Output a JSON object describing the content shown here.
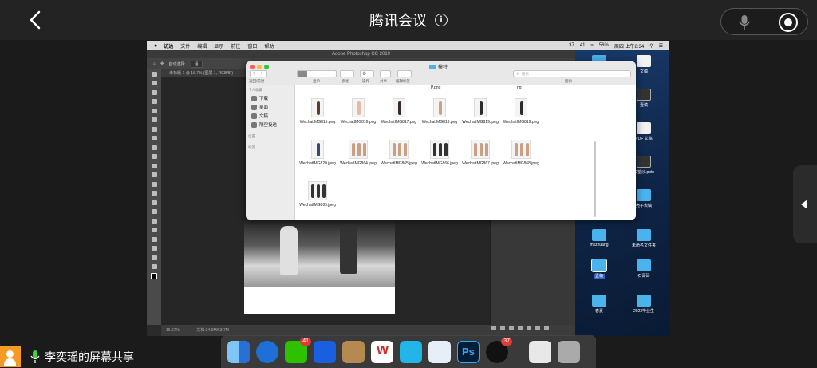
{
  "meeting": {
    "title": "腾讯会议",
    "sharer_label": "李奕瑶的屏幕共享"
  },
  "mac": {
    "menubar": {
      "app": "访达",
      "items": [
        "文件",
        "编辑",
        "显示",
        "前往",
        "窗口",
        "帮助"
      ],
      "status": {
        "badge_37": "37",
        "badge_41": "41",
        "battery": "56%",
        "clock": "周四 上午8:34"
      }
    },
    "photoshop": {
      "window_title": "Adobe Photoshop CC 2019",
      "tab_label": "未标题-1 @ 16.7% (图层 1, RGB/8*)",
      "zoom": "16.67%",
      "doc_info": "文档:24.9M/63.7M",
      "option_auto_select": "自动选择:",
      "option_group": "组"
    },
    "finder": {
      "folder_title": "模特",
      "toolbar_labels": {
        "back": "返回/前进",
        "view": "显示",
        "group": "群组",
        "action": "操作",
        "share": "共享",
        "tags": "编辑标签",
        "search": "搜索"
      },
      "search_placeholder": "搜索",
      "sidebar": {
        "favorites_header": "个人收藏",
        "items": [
          "下载",
          "桌面",
          "文稿",
          "隔空投送"
        ],
        "locations_header": "位置",
        "tags_header": "标签"
      },
      "partial_top": [
        "P.png",
        "ng"
      ],
      "files": [
        {
          "name": "WechatIMG815.png"
        },
        {
          "name": "WechatIMG816.png"
        },
        {
          "name": "WechatIMG817.png"
        },
        {
          "name": "WechatIMG818.png"
        },
        {
          "name": "WechatIMG819.jpeg"
        },
        {
          "name": "WechatIMG819.png"
        },
        {
          "name": "WechatIMG820.jpeg"
        },
        {
          "name": "WechatIMG864.jpeg"
        },
        {
          "name": "WechatIMG865.jpeg"
        },
        {
          "name": "WechatIMG866.jpeg"
        },
        {
          "name": "WechatIMG867.jpeg"
        },
        {
          "name": "WechatIMG868.jpeg"
        },
        {
          "name": "WechatIMG869.jpeg"
        }
      ]
    },
    "desktop_icons": [
      {
        "label": "",
        "kind": "folder"
      },
      {
        "label": "文稿",
        "kind": "doc"
      },
      {
        "label": "壹稿",
        "kind": "pic"
      },
      {
        "label": "PDF 文稿",
        "kind": "doc"
      },
      {
        "label": "公望沙.pptx",
        "kind": "pic"
      },
      {
        "label": "壳子表稿",
        "kind": "folder"
      },
      {
        "label": "mxzhuang",
        "kind": "folder"
      },
      {
        "label": "未命名文件夹",
        "kind": "folder"
      },
      {
        "label": "壹稿",
        "kind": "folder"
      },
      {
        "label": "石膏码",
        "kind": "folder"
      },
      {
        "label": "春夏",
        "kind": "folder"
      },
      {
        "label": "2023毕业生",
        "kind": "folder"
      }
    ],
    "dock": {
      "wechat_badge": "41",
      "qq_badge": "37"
    }
  }
}
